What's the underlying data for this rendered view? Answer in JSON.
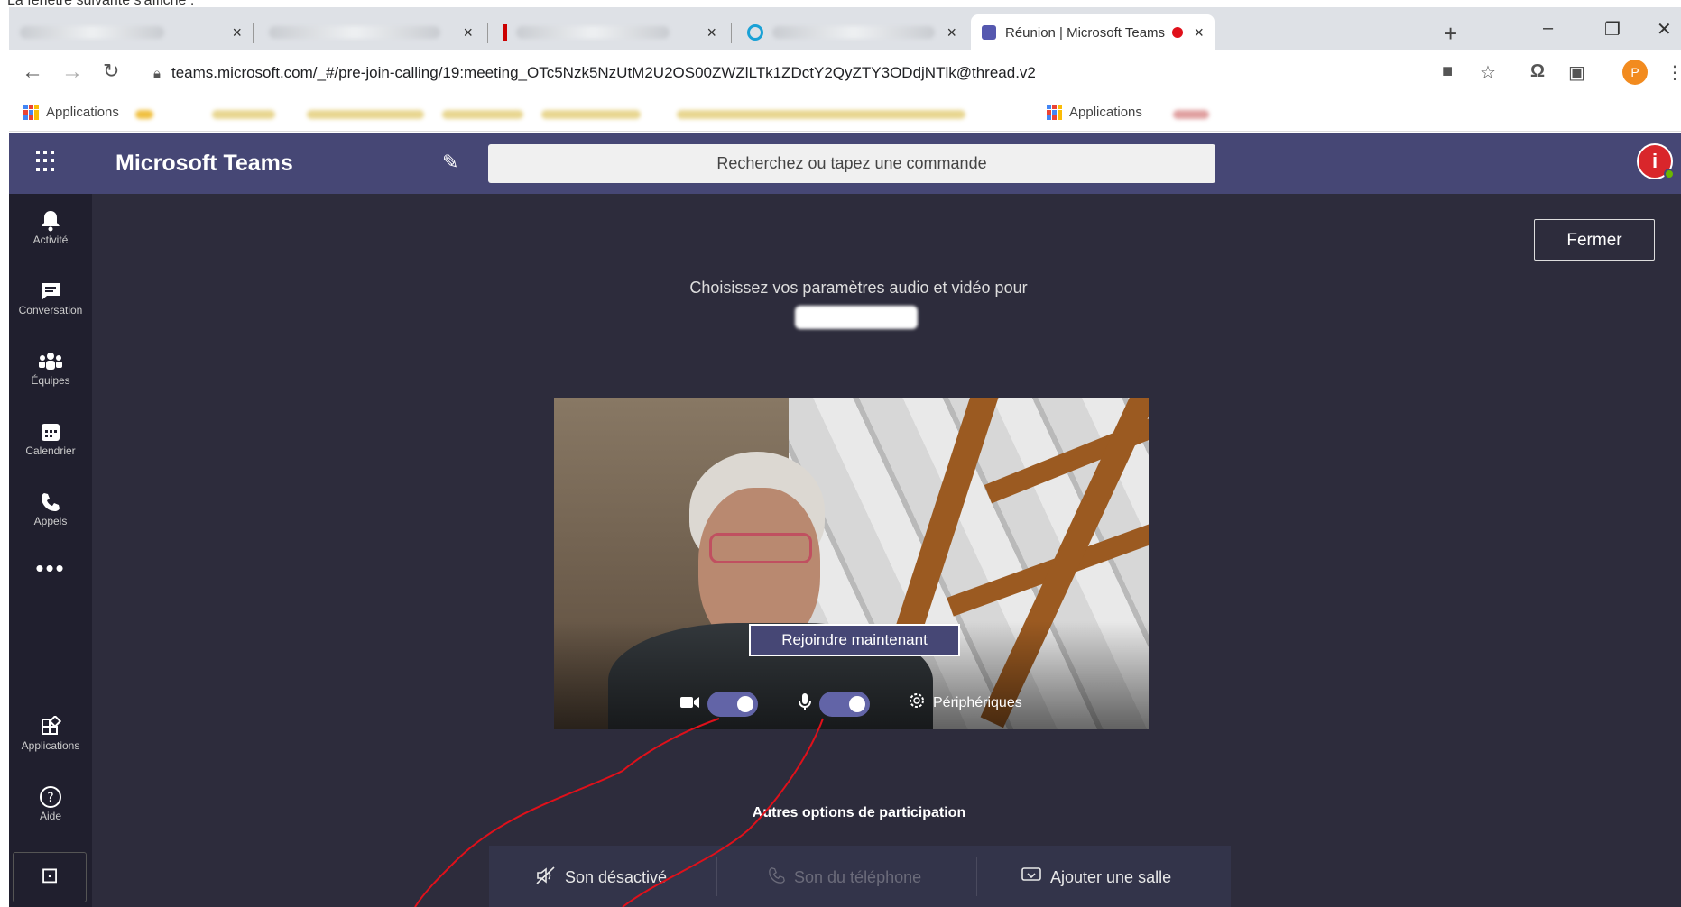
{
  "caption": "La fenêtre suivante s'affiche :",
  "browser": {
    "tabs": [
      {
        "label": "",
        "close": "×",
        "active": false
      },
      {
        "label": "",
        "close": "×",
        "active": false
      },
      {
        "label": "",
        "close": "×",
        "active": false
      },
      {
        "label": "",
        "close": "×",
        "active": false
      },
      {
        "label": "Réunion | Microsoft Teams",
        "close": "×",
        "active": true
      }
    ],
    "new_tab": "+",
    "window_controls": {
      "minimize": "–",
      "restore": "❐",
      "close": "✕"
    },
    "url": "teams.microsoft.com/_#/pre-join-calling/19:meeting_OTc5Nzk5NzUtM2U2OS00ZWZlLTk1ZDctY2QyZTY3ODdjNTlk@thread.v2",
    "profile_initial": "P",
    "bookmarks": [
      {
        "label": "Applications"
      },
      {
        "label": "Applications"
      }
    ]
  },
  "teams": {
    "app_title": "Microsoft Teams",
    "search_placeholder": "Recherchez ou tapez une commande",
    "avatar_initial": "i",
    "rail": [
      {
        "label": "Activité",
        "icon": "bell-icon"
      },
      {
        "label": "Conversation",
        "icon": "chat-icon"
      },
      {
        "label": "Équipes",
        "icon": "teams-icon"
      },
      {
        "label": "Calendrier",
        "icon": "calendar-icon"
      },
      {
        "label": "Appels",
        "icon": "phone-icon"
      },
      {
        "label": "Applications",
        "icon": "apps-icon"
      },
      {
        "label": "Aide",
        "icon": "help-icon"
      }
    ],
    "more": "•••",
    "close_button": "Fermer",
    "prompt": "Choisissez vos paramètres audio et vidéo pour",
    "join_button": "Rejoindre maintenant",
    "camera_on": true,
    "mic_on": true,
    "devices_label": "Périphériques",
    "other_options_title": "Autres options de participation",
    "options": [
      {
        "label": "Son désactivé",
        "icon": "speaker-off-icon",
        "enabled": true
      },
      {
        "label": "Son du téléphone",
        "icon": "phone-icon",
        "enabled": false
      },
      {
        "label": "Ajouter une salle",
        "icon": "cast-icon",
        "enabled": true
      }
    ]
  },
  "colors": {
    "teams_header": "#464775",
    "teams_bg": "#2d2c3c",
    "rail_bg": "#201f2e",
    "toggle_on": "#6264a7",
    "annotation": "#e0101a"
  }
}
